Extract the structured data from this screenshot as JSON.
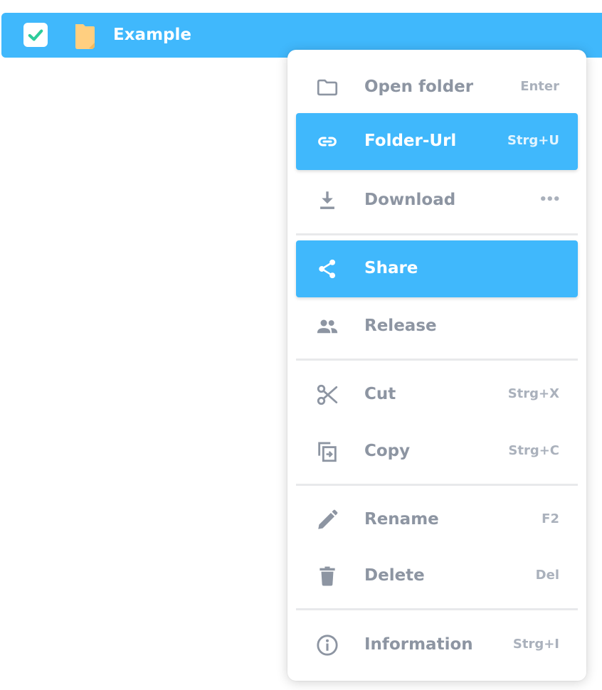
{
  "file": {
    "name": "Example",
    "checked": true,
    "row_color": "#40b8fc",
    "check_color": "#2ecc9b",
    "folder_color": "#ffcf80"
  },
  "menu": {
    "items": [
      {
        "label": "Open folder",
        "shortcut": "Enter",
        "icon": "folder-icon"
      },
      {
        "label": "Folder-Url",
        "shortcut": "Strg+U",
        "icon": "link-icon",
        "active": true
      },
      {
        "label": "Download",
        "shortcut": "•••",
        "icon": "download-icon"
      },
      {
        "label": "Share",
        "shortcut": "",
        "icon": "share-icon",
        "active": true
      },
      {
        "label": "Release",
        "shortcut": "",
        "icon": "people-icon"
      },
      {
        "label": "Cut",
        "shortcut": "Strg+X",
        "icon": "scissors-icon"
      },
      {
        "label": "Copy",
        "shortcut": "Strg+C",
        "icon": "copy-icon"
      },
      {
        "label": "Rename",
        "shortcut": "F2",
        "icon": "pencil-icon"
      },
      {
        "label": "Delete",
        "shortcut": "Del",
        "icon": "trash-icon"
      },
      {
        "label": "Information",
        "shortcut": "Strg+I",
        "icon": "info-icon"
      }
    ],
    "colors": {
      "text": "#8d95a2",
      "shortcut": "#aab1bc",
      "active_bg": "#40b8fc",
      "divider": "#e8e9eb"
    }
  }
}
